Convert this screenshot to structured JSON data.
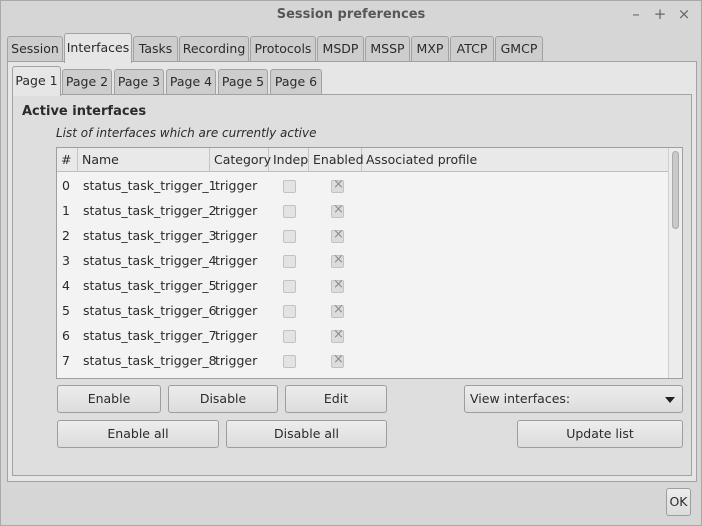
{
  "window": {
    "title": "Session preferences"
  },
  "window_controls": {
    "minimize": "–",
    "maximize": "+",
    "close": "×"
  },
  "outer_tabs": [
    {
      "label": "Session"
    },
    {
      "label": "Interfaces",
      "active": true
    },
    {
      "label": "Tasks"
    },
    {
      "label": "Recording"
    },
    {
      "label": "Protocols"
    },
    {
      "label": "MSDP"
    },
    {
      "label": "MSSP"
    },
    {
      "label": "MXP"
    },
    {
      "label": "ATCP"
    },
    {
      "label": "GMCP"
    }
  ],
  "inner_tabs": [
    {
      "label": "Page 1",
      "active": true
    },
    {
      "label": "Page 2"
    },
    {
      "label": "Page 3"
    },
    {
      "label": "Page 4"
    },
    {
      "label": "Page 5"
    },
    {
      "label": "Page 6"
    }
  ],
  "group": {
    "title": "Active interfaces",
    "subtitle": "List of interfaces which are currently active"
  },
  "table": {
    "columns": [
      "#",
      "Name",
      "Category",
      "Indep",
      "Enabled",
      "Associated profile"
    ],
    "rows": [
      {
        "num": "0",
        "name": "status_task_trigger_1",
        "category": "trigger",
        "indep": false,
        "enabled": true,
        "profile": ""
      },
      {
        "num": "1",
        "name": "status_task_trigger_2",
        "category": "trigger",
        "indep": false,
        "enabled": true,
        "profile": ""
      },
      {
        "num": "2",
        "name": "status_task_trigger_3",
        "category": "trigger",
        "indep": false,
        "enabled": true,
        "profile": ""
      },
      {
        "num": "3",
        "name": "status_task_trigger_4",
        "category": "trigger",
        "indep": false,
        "enabled": true,
        "profile": ""
      },
      {
        "num": "4",
        "name": "status_task_trigger_5",
        "category": "trigger",
        "indep": false,
        "enabled": true,
        "profile": ""
      },
      {
        "num": "5",
        "name": "status_task_trigger_6",
        "category": "trigger",
        "indep": false,
        "enabled": true,
        "profile": ""
      },
      {
        "num": "6",
        "name": "status_task_trigger_7",
        "category": "trigger",
        "indep": false,
        "enabled": true,
        "profile": ""
      },
      {
        "num": "7",
        "name": "status_task_trigger_8",
        "category": "trigger",
        "indep": false,
        "enabled": true,
        "profile": ""
      }
    ]
  },
  "buttons": {
    "enable": "Enable",
    "disable": "Disable",
    "edit": "Edit",
    "view_interfaces": "View interfaces:",
    "enable_all": "Enable all",
    "disable_all": "Disable all",
    "update_list": "Update list",
    "ok": "OK"
  }
}
